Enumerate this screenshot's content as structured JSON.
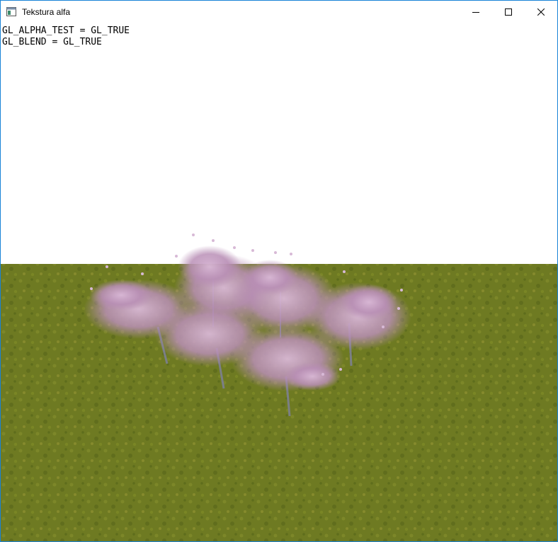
{
  "window": {
    "title": "Tekstura alfa",
    "icon": "window-app-icon",
    "controls": [
      "minimize-icon",
      "maximize-icon",
      "close-icon"
    ],
    "accent_color": "#1883d7"
  },
  "overlay": {
    "lines": [
      "GL_ALPHA_TEST = GL_TRUE",
      "GL_BLEND = GL_TRUE"
    ]
  },
  "scene": {
    "sky_color": "#ffffff",
    "grass_color": "#6e7a22",
    "blossom_color": "#c9a3c8",
    "trunk_color": "#7b7f86"
  }
}
